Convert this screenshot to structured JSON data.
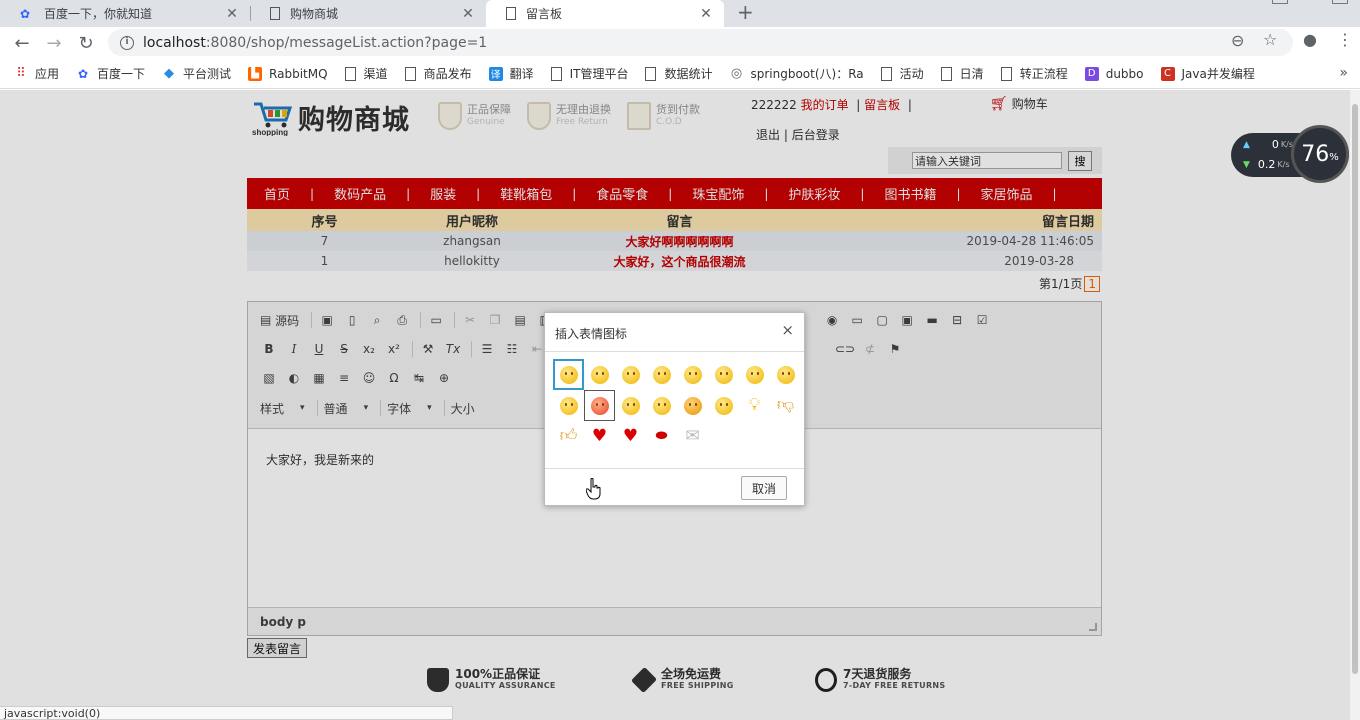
{
  "browser": {
    "tabs": [
      {
        "title": "百度一下，你就知道",
        "active": false
      },
      {
        "title": "购物商城",
        "active": false
      },
      {
        "title": "留言板",
        "active": true
      }
    ],
    "new_tab": "+",
    "url_host": "localhost",
    "url_path": ":8080/shop/messageList.action?page=1",
    "bookmarks": [
      {
        "label": "应用",
        "icon": "apps-grid-icon"
      },
      {
        "label": "百度一下",
        "icon": "baidu-paw-icon"
      },
      {
        "label": "平台测试",
        "icon": "diamond-icon"
      },
      {
        "label": "RabbitMQ",
        "icon": "rabbitmq-icon"
      },
      {
        "label": "渠道",
        "icon": "page-icon"
      },
      {
        "label": "商品发布",
        "icon": "page-icon"
      },
      {
        "label": "翻译",
        "icon": "translate-icon"
      },
      {
        "label": "IT管理平台",
        "icon": "page-icon"
      },
      {
        "label": "数据统计",
        "icon": "page-icon"
      },
      {
        "label": "springboot(八)：Ra",
        "icon": "globe-icon"
      },
      {
        "label": "活动",
        "icon": "page-icon"
      },
      {
        "label": "日清",
        "icon": "page-icon"
      },
      {
        "label": "转正流程",
        "icon": "page-icon"
      },
      {
        "label": "dubbo",
        "icon": "dubbo-icon"
      },
      {
        "label": "Java并发编程",
        "icon": "csdn-icon"
      }
    ],
    "more": "»",
    "status_text": "javascript:void(0)"
  },
  "site": {
    "logo_name": "购物商城",
    "logo_sub": "shopping",
    "badges": [
      {
        "title": "正品保障",
        "sub": "Genuine"
      },
      {
        "title": "无理由退换",
        "sub": "Free Return"
      },
      {
        "title": "货到付款",
        "sub": "C.O.D"
      }
    ],
    "user": "222222",
    "my_orders": "我的订单",
    "message_board": "留言板",
    "sep": "|",
    "logout": "退出",
    "admin_login": "后台登录",
    "cart": "购物车",
    "search_placeholder": "请输入关键词",
    "search_button": "搜",
    "nav": [
      "首页",
      "数码产品",
      "服装",
      "鞋靴箱包",
      "食品零食",
      "珠宝配饰",
      "护肤彩妆",
      "图书书籍",
      "家居饰品"
    ]
  },
  "table": {
    "headers": [
      "序号",
      "用户昵称",
      "留言",
      "留言日期"
    ],
    "rows": [
      {
        "id": "7",
        "user": "zhangsan",
        "message": "大家好啊啊啊啊啊啊",
        "date": "2019-04-28 11:46:05"
      },
      {
        "id": "1",
        "user": "hellokitty",
        "message": "大家好，这个商品很潮流",
        "date": "2019-03-28"
      }
    ],
    "pager_label": "第1/1页",
    "pager_current": "1"
  },
  "editor": {
    "source_label": "源码",
    "style_combo": "样式",
    "format_combo": "普通",
    "font_combo": "字体",
    "size_combo": "大小",
    "content": "大家好，我是新来的",
    "path": "body  p",
    "submit_label": "发表留言"
  },
  "dialog": {
    "title": "插入表情图标",
    "close": "×",
    "cancel": "取消",
    "smileys": [
      "regular-smile-icon",
      "sad-smile-icon",
      "wink-smile-icon",
      "teeth-smile-icon",
      "confused-smile-icon",
      "tongue-smile-icon",
      "embarrassed-smile-icon",
      "omg-smile-icon",
      "whatchutalkingabout-smile-icon",
      "angry-smile-icon",
      "angel-smile-icon",
      "shades-smile-icon",
      "devil-smile-icon",
      "cry-smile-icon",
      "lightbulb-icon",
      "thumbs-down-icon",
      "thumbs-up-icon",
      "heart-icon",
      "broken-heart-icon",
      "kiss-icon",
      "envelope-icon"
    ]
  },
  "footer": [
    {
      "title": "100%正品保证",
      "sub": "QUALITY ASSURANCE",
      "icon": "shield-icon"
    },
    {
      "title": "全场免运费",
      "sub": "FREE SHIPPING",
      "icon": "box-icon"
    },
    {
      "title": "7天退货服务",
      "sub": "7-DAY FREE RETURNS",
      "icon": "clock-icon"
    }
  ],
  "speed_widget": {
    "up": "0",
    "down": "0.2",
    "unit": "K/s",
    "percent": "76",
    "percent_sign": "%"
  },
  "colors": {
    "nav_red": "#cc0000",
    "table_header": "#fde6b5",
    "selected_smiley_border": "#3399cc"
  }
}
